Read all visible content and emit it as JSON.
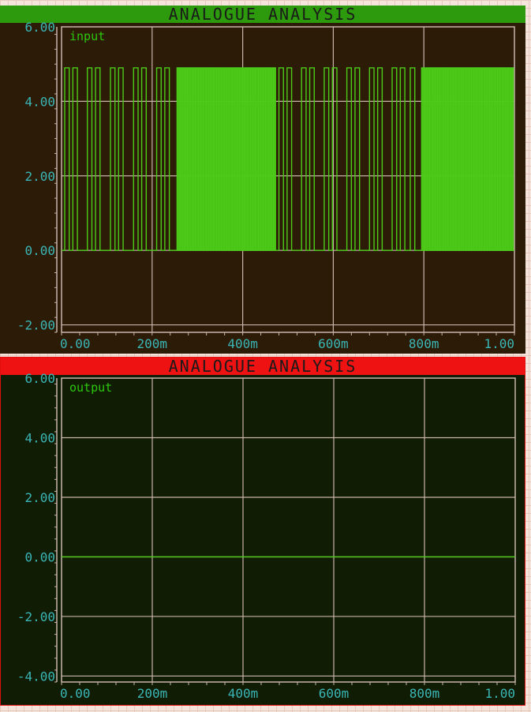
{
  "colors": {
    "top_background": "#2c1b06",
    "bottom_background": "#101c04",
    "top_title_bar": "#2c9a0c",
    "bottom_title_bar": "#ee1212",
    "grid": "#c9b3ab",
    "trace": "#4ccc18",
    "tick_label": "#3ab6b6",
    "series_label": "#2cc80c"
  },
  "chart_data": [
    {
      "type": "line",
      "title": "ANALOGUE ANALYSIS",
      "series": [
        {
          "name": "input",
          "kind": "pulse-train",
          "low": 0,
          "high": 4.9,
          "pulses": [
            [
              0.007,
              0.017
            ],
            [
              0.025,
              0.035
            ],
            [
              0.057,
              0.067
            ],
            [
              0.075,
              0.085
            ],
            [
              0.108,
              0.118
            ],
            [
              0.126,
              0.136
            ],
            [
              0.159,
              0.169
            ],
            [
              0.177,
              0.187
            ],
            [
              0.21,
              0.22
            ],
            [
              0.228,
              0.238
            ]
          ],
          "dense_regions": [
            {
              "start": 0.255,
              "end": 0.475,
              "period": 0.005
            },
            {
              "start": 0.795,
              "end": 1.0,
              "period": 0.005
            }
          ],
          "pulses_mid": [
            [
              0.48,
              0.49
            ],
            [
              0.498,
              0.508
            ],
            [
              0.53,
              0.54
            ],
            [
              0.548,
              0.558
            ],
            [
              0.58,
              0.59
            ],
            [
              0.598,
              0.608
            ],
            [
              0.63,
              0.64
            ],
            [
              0.648,
              0.658
            ],
            [
              0.68,
              0.69
            ],
            [
              0.698,
              0.708
            ],
            [
              0.73,
              0.74
            ],
            [
              0.748,
              0.758
            ],
            [
              0.77,
              0.78
            ]
          ]
        }
      ],
      "xlim": [
        0,
        1.0
      ],
      "ylim": [
        -2.2,
        6.0
      ],
      "xticks": [
        0,
        0.2,
        0.4,
        0.6,
        0.8,
        1.0
      ],
      "xtick_labels": [
        "0.00",
        "200m",
        "400m",
        "600m",
        "800m",
        "1.00"
      ],
      "yticks": [
        6,
        4,
        2,
        0,
        -2
      ],
      "ytick_labels": [
        "6.00",
        "4.00",
        "2.00",
        "0.00",
        "-2.00"
      ],
      "grid": true
    },
    {
      "type": "line",
      "title": "ANALOGUE ANALYSIS",
      "series": [
        {
          "name": "output",
          "x": [
            0,
            1.0
          ],
          "y": [
            0,
            0
          ]
        }
      ],
      "xlim": [
        0,
        1.0
      ],
      "ylim": [
        -4.2,
        6.0
      ],
      "xticks": [
        0,
        0.2,
        0.4,
        0.6,
        0.8,
        1.0
      ],
      "xtick_labels": [
        "0.00",
        "200m",
        "400m",
        "600m",
        "800m",
        "1.00"
      ],
      "yticks": [
        6,
        4,
        2,
        0,
        -2,
        -4
      ],
      "ytick_labels": [
        "6.00",
        "4.00",
        "2.00",
        "0.00",
        "-2.00",
        "-4.00"
      ],
      "grid": true
    }
  ]
}
